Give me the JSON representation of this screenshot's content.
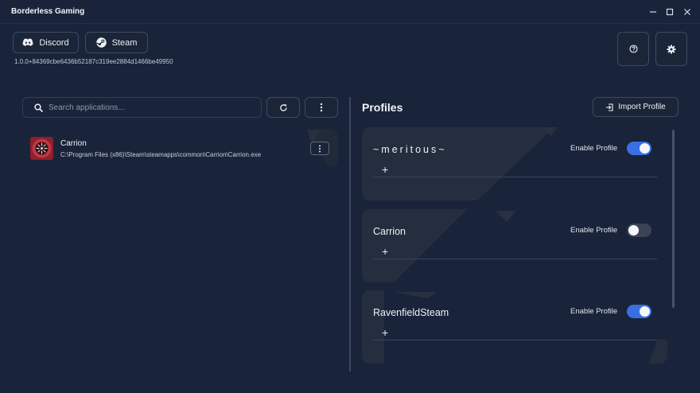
{
  "window": {
    "title": "Borderless Gaming",
    "controls": {
      "minimize": "—",
      "maximize": "☐",
      "close": "✕"
    }
  },
  "header": {
    "discord_label": "Discord",
    "steam_label": "Steam",
    "version": "1.0.0+84369cbe6436b52187c319ee2884d1466be49950",
    "icons": {
      "discord": "discord-icon",
      "steam": "steam-icon",
      "help": "help-icon",
      "settings": "gear-icon"
    }
  },
  "applications": {
    "search_placeholder": "Search applications...",
    "search_value": "",
    "items": [
      {
        "name": "Carrion",
        "path": "C:\\Program Files (x86)\\Steam\\steamapps\\common\\Carrion\\Carrion.exe"
      }
    ]
  },
  "profiles": {
    "title": "Profiles",
    "import_label": "Import Profile",
    "items": [
      {
        "name": "~meritous~",
        "enable_label": "Enable Profile",
        "enabled": true,
        "add_label": "+"
      },
      {
        "name": "Carrion",
        "enable_label": "Enable Profile",
        "enabled": false,
        "add_label": "+"
      },
      {
        "name": "RavenfieldSteam",
        "enable_label": "Enable Profile",
        "enabled": true,
        "add_label": "+"
      }
    ]
  },
  "colors": {
    "background": "#19243a",
    "card": "#252e3e",
    "accent": "#3a6fe3",
    "toggle_off": "#3b4455"
  }
}
